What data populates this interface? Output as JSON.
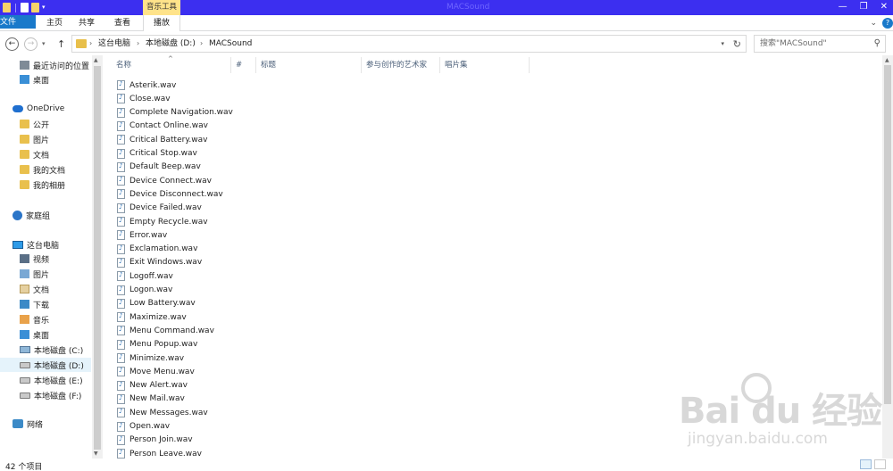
{
  "window": {
    "title": "MACSound",
    "controls": [
      "—",
      "❐",
      "✕"
    ]
  },
  "ribbon": {
    "tabs": {
      "file": "文件",
      "home": "主页",
      "share": "共享",
      "view": "查看"
    },
    "context_group": "音乐工具",
    "context_tab": "播放",
    "help": "?"
  },
  "address": {
    "crumbs": [
      "这台电脑",
      "本地磁盘 (D:)",
      "MACSound"
    ],
    "separator": "›"
  },
  "search": {
    "placeholder": "搜索\"MACSound\""
  },
  "nav": {
    "items": [
      {
        "label": "最近访问的位置",
        "icon": "recent-icon"
      },
      {
        "label": "桌面",
        "icon": "desktop-icon"
      },
      {
        "label": "OneDrive",
        "icon": "onedrive-icon"
      },
      {
        "label": "公开",
        "icon": "folder-icon"
      },
      {
        "label": "图片",
        "icon": "folder-icon"
      },
      {
        "label": "文档",
        "icon": "folder-icon"
      },
      {
        "label": "我的文档",
        "icon": "folder-icon"
      },
      {
        "label": "我的相册",
        "icon": "folder-icon"
      },
      {
        "label": "家庭组",
        "icon": "homegroup-icon"
      },
      {
        "label": "这台电脑",
        "icon": "pc-icon"
      },
      {
        "label": "视频",
        "icon": "videos-icon"
      },
      {
        "label": "图片",
        "icon": "pictures-icon"
      },
      {
        "label": "文档",
        "icon": "documents-icon"
      },
      {
        "label": "下载",
        "icon": "downloads-icon"
      },
      {
        "label": "音乐",
        "icon": "music-icon"
      },
      {
        "label": "桌面",
        "icon": "desktop-icon"
      },
      {
        "label": "本地磁盘 (C:)",
        "icon": "system-drive-icon"
      },
      {
        "label": "本地磁盘 (D:)",
        "icon": "drive-icon",
        "selected": true
      },
      {
        "label": "本地磁盘 (E:)",
        "icon": "drive-icon"
      },
      {
        "label": "本地磁盘 (F:)",
        "icon": "drive-icon"
      },
      {
        "label": "网络",
        "icon": "network-icon"
      }
    ]
  },
  "columns": [
    "名称",
    "#",
    "标题",
    "参与创作的艺术家",
    "唱片集"
  ],
  "files": [
    "Asterik.wav",
    "Close.wav",
    "Complete Navigation.wav",
    "Contact Online.wav",
    "Critical Battery.wav",
    "Critical Stop.wav",
    "Default Beep.wav",
    "Device Connect.wav",
    "Device Disconnect.wav",
    "Device Failed.wav",
    "Empty Recycle.wav",
    "Error.wav",
    "Exclamation.wav",
    "Exit Windows.wav",
    "Logoff.wav",
    "Logon.wav",
    "Low Battery.wav",
    "Maximize.wav",
    "Menu Command.wav",
    "Menu Popup.wav",
    "Minimize.wav",
    "Move Menu.wav",
    "New Alert.wav",
    "New Mail.wav",
    "New Messages.wav",
    "Open.wav",
    "Person Join.wav",
    "Person Leave.wav"
  ],
  "status": {
    "count": "42 个项目"
  },
  "watermark": {
    "brand": "Bai du 经验",
    "url": "jingyan.baidu.com"
  }
}
